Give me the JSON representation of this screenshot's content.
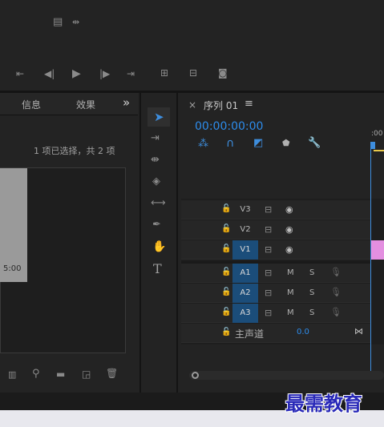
{
  "monitor": {
    "top_icons": [
      "export-frame-icon",
      "wrench-arrows-icon"
    ],
    "controls": [
      "mark-in-icon",
      "step-back-icon",
      "play-icon",
      "step-forward-icon",
      "mark-out-icon",
      "lift-icon",
      "extract-icon",
      "camera-icon"
    ]
  },
  "project": {
    "tab_info": "信息",
    "tab_effects": "效果",
    "more": "»",
    "selection_text": "1 项已选择，共 2 项",
    "thumb_time": "5:00",
    "footer_icons": [
      "icon-view-icon",
      "search-icon",
      "folder-icon",
      "new-item-icon",
      "trash-icon"
    ]
  },
  "tools": [
    "selection-tool-icon",
    "track-select-tool-icon",
    "ripple-edit-tool-icon",
    "razor-tool-icon",
    "slip-tool-icon",
    "pen-tool-icon",
    "hand-tool-icon",
    "type-tool-icon"
  ],
  "timeline": {
    "close": "×",
    "sequence_name": "序列 01",
    "menu": "≡",
    "timecode": "00:00:00:00",
    "ruler_label": ":00",
    "video_tracks": [
      {
        "name": "V3",
        "selected": false
      },
      {
        "name": "V2",
        "selected": false
      },
      {
        "name": "V1",
        "selected": true
      }
    ],
    "audio_tracks": [
      {
        "name": "A1",
        "m": "M",
        "s": "S"
      },
      {
        "name": "A2",
        "m": "M",
        "s": "S"
      },
      {
        "name": "A3",
        "m": "M",
        "s": "S"
      }
    ],
    "master_label": "主声道",
    "master_value": "0.0"
  },
  "watermark": "最需教育",
  "colors": {
    "accent_blue": "#3e8ede",
    "timecode_blue": "#2d8ceb",
    "clip_pink": "#e38fe0",
    "selected_track": "#1b4d7a"
  }
}
